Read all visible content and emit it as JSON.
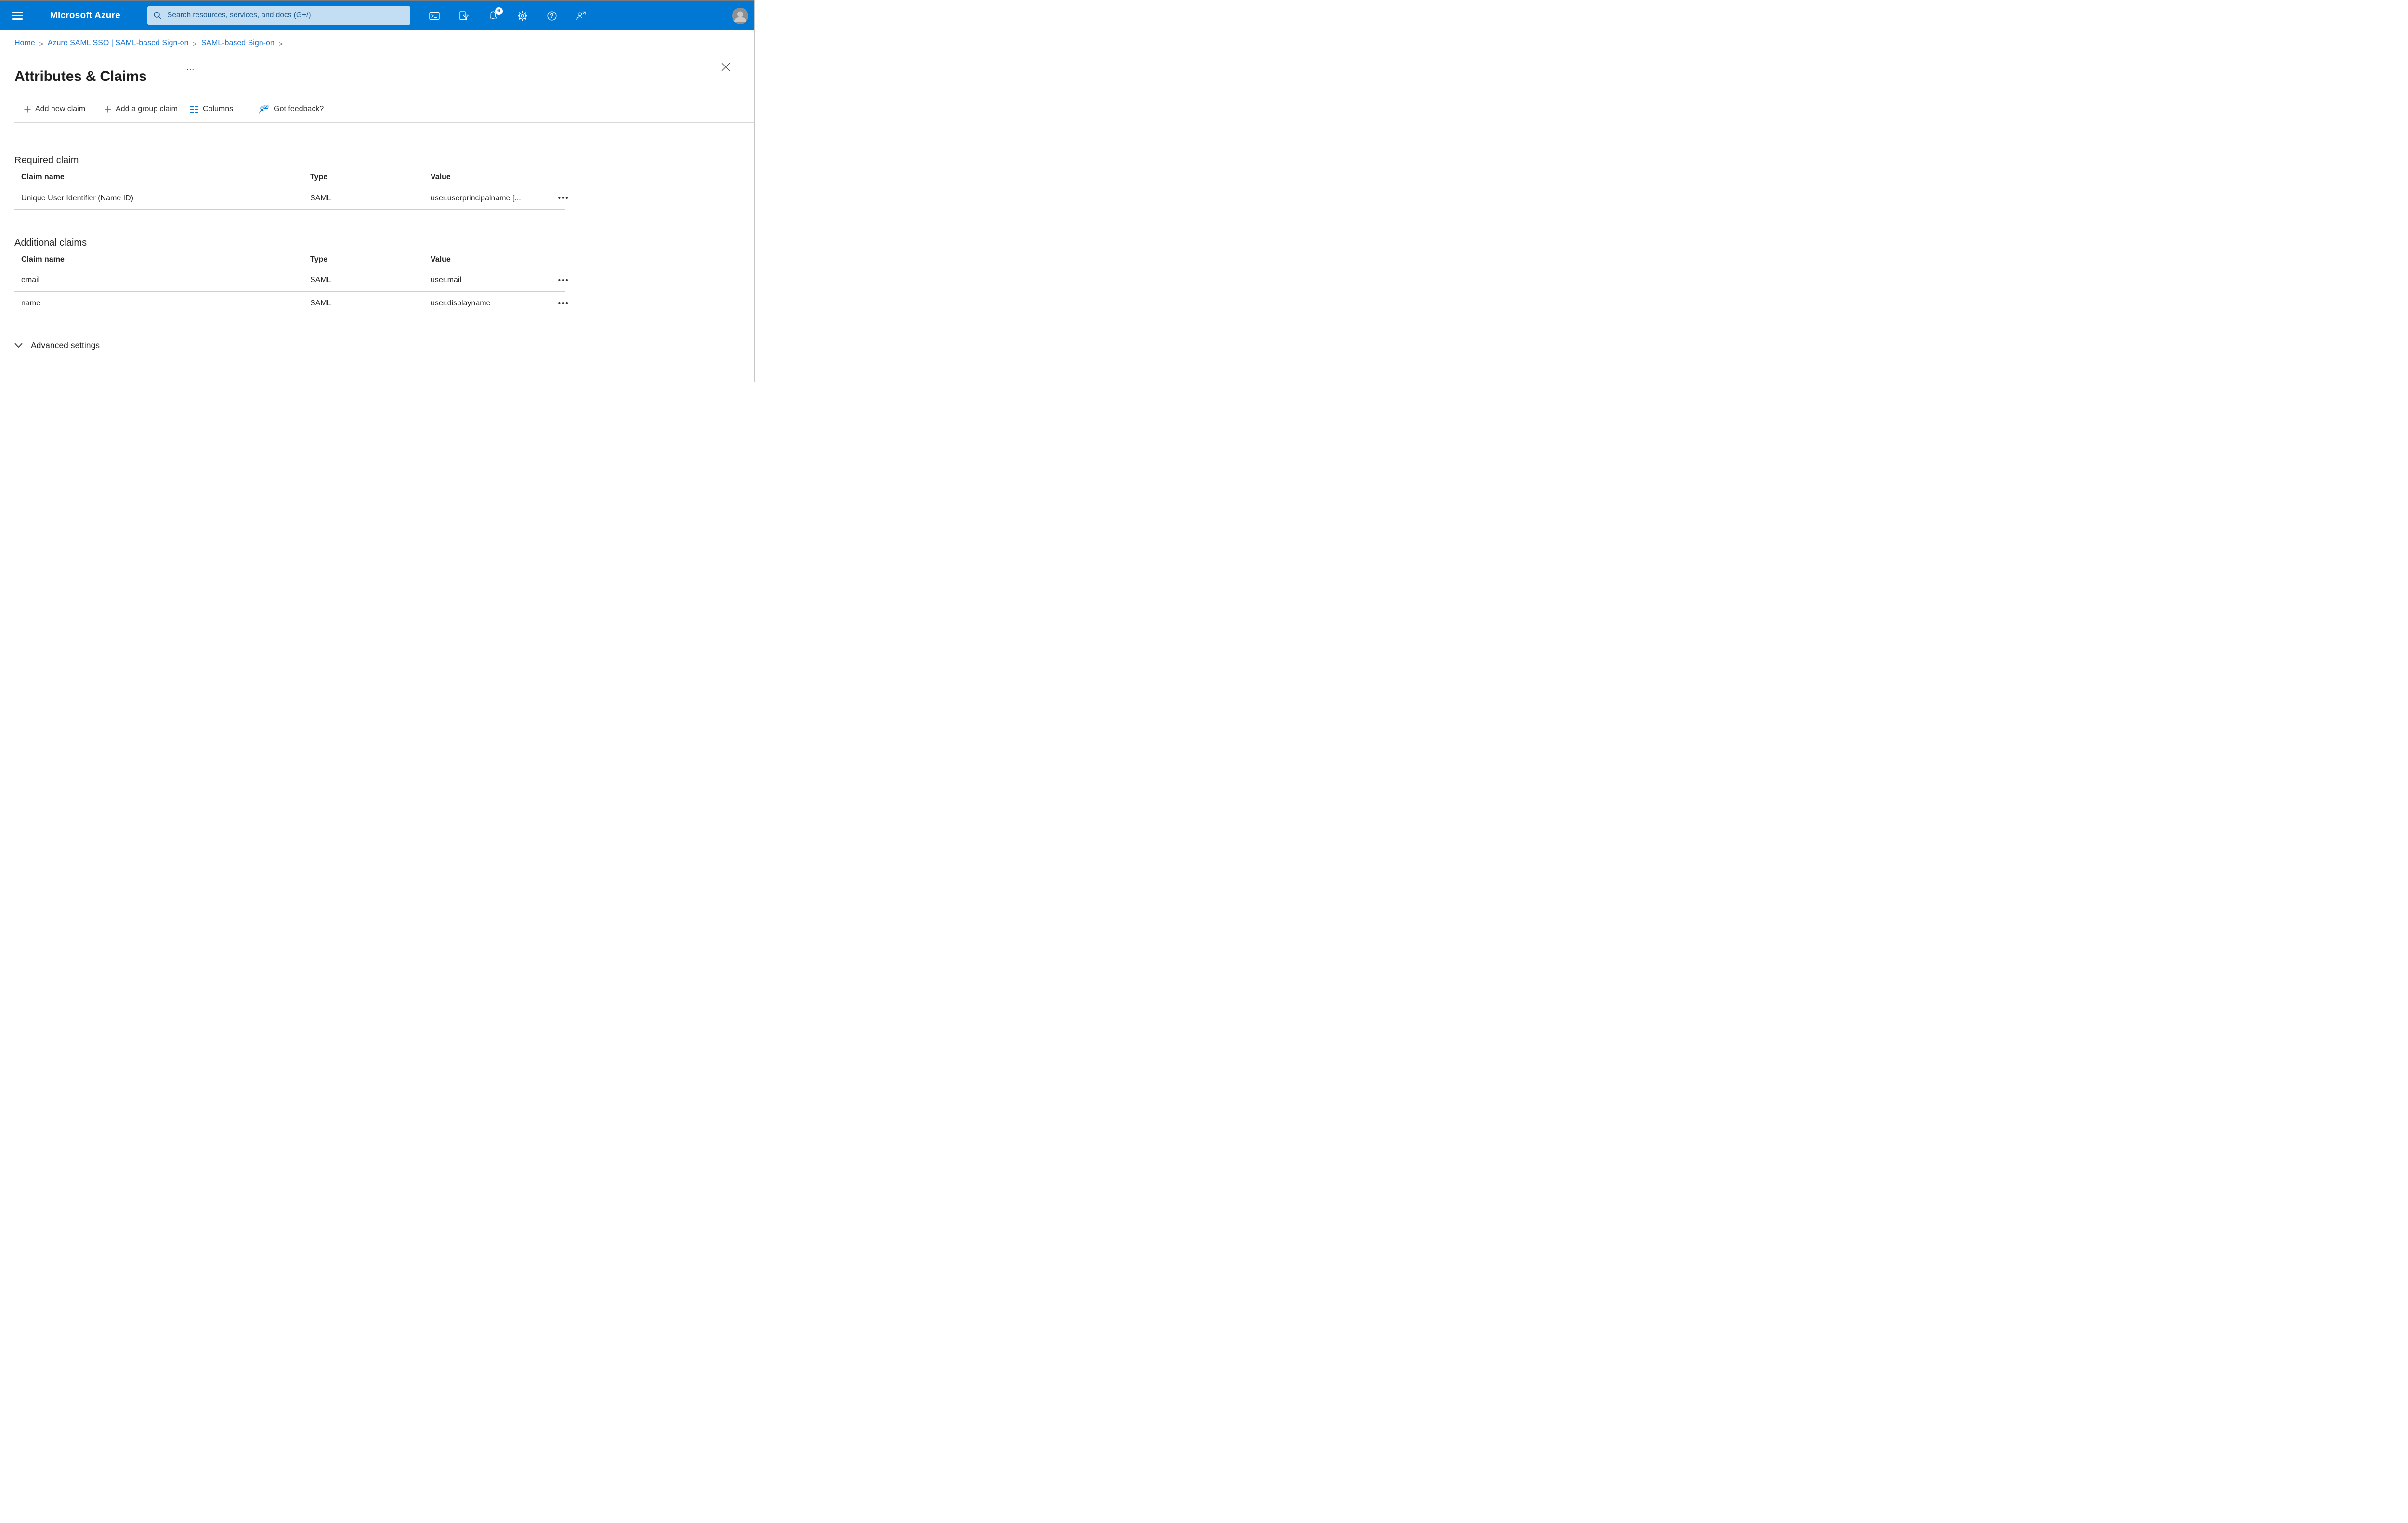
{
  "colors": {
    "topbar": "#0078d4",
    "accent": "#0078d4",
    "link": "#1673d2",
    "search_bg": "#c3ddf2",
    "search_text": "#1f5b8e"
  },
  "topbar": {
    "brand": "Microsoft Azure",
    "search_placeholder": "Search resources, services, and docs (G+/)",
    "notification_count": "6"
  },
  "breadcrumb": {
    "separator": ">",
    "items": [
      {
        "label": "Home"
      },
      {
        "label": "Azure SAML SSO | SAML-based Sign-on"
      },
      {
        "label": "SAML-based Sign-on"
      }
    ]
  },
  "page": {
    "title": "Attributes & Claims",
    "overflow": "…"
  },
  "toolbar": {
    "add_new_claim": "Add new claim",
    "add_group_claim": "Add a group claim",
    "columns": "Columns",
    "got_feedback": "Got feedback?"
  },
  "glyphs": {
    "row_menu": "•••"
  },
  "required_claim": {
    "heading": "Required claim",
    "columns": [
      "Claim name",
      "Type",
      "Value"
    ],
    "rows": [
      {
        "claim_name": "Unique User Identifier (Name ID)",
        "type": "SAML",
        "value": "user.userprincipalname [..."
      }
    ]
  },
  "additional_claims": {
    "heading": "Additional claims",
    "columns": [
      "Claim name",
      "Type",
      "Value"
    ],
    "rows": [
      {
        "claim_name": "email",
        "type": "SAML",
        "value": "user.mail"
      },
      {
        "claim_name": "name",
        "type": "SAML",
        "value": "user.displayname"
      }
    ]
  },
  "advanced": {
    "label": "Advanced settings"
  }
}
